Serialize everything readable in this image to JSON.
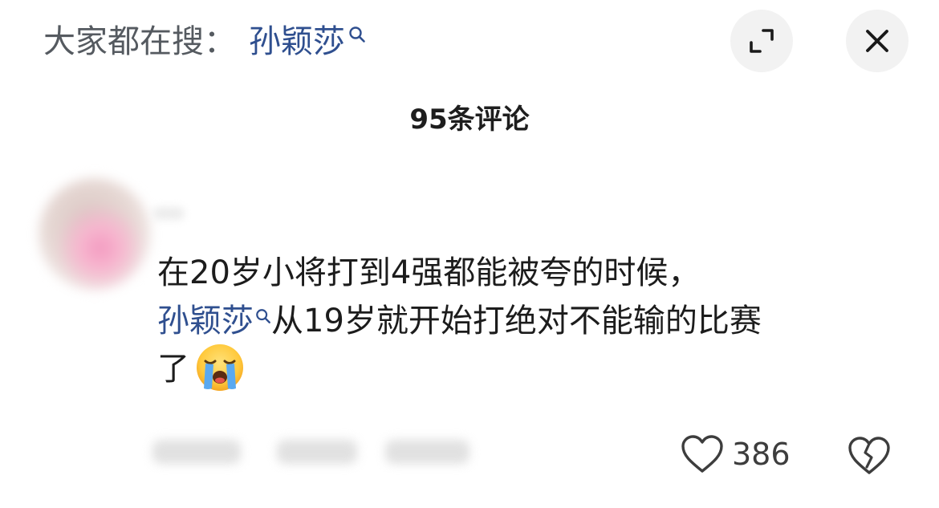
{
  "header": {
    "prefix": "大家都在搜：",
    "search_term": "孙颖莎",
    "search_icon": "search-icon",
    "expand_icon": "expand-icon",
    "close_icon": "close-icon"
  },
  "comments_header": {
    "count_label": "95条评论"
  },
  "comment": {
    "avatar": "avatar",
    "lines": {
      "line1": "在20岁小将打到4强都能被夸的时候，",
      "mention": "孙颖莎",
      "line2_rest": "从19岁就开始打绝对不能输的比赛",
      "line3": "了"
    },
    "emoji": "loudly-crying-face-emoji",
    "like_icon": "heart-outline-icon",
    "like_count": "386",
    "dislike_icon": "broken-heart-icon"
  },
  "colors": {
    "link": "#2f4f8f",
    "text": "#1c1c1c",
    "muted": "#555a60",
    "button_bg": "#f2f2f2"
  }
}
